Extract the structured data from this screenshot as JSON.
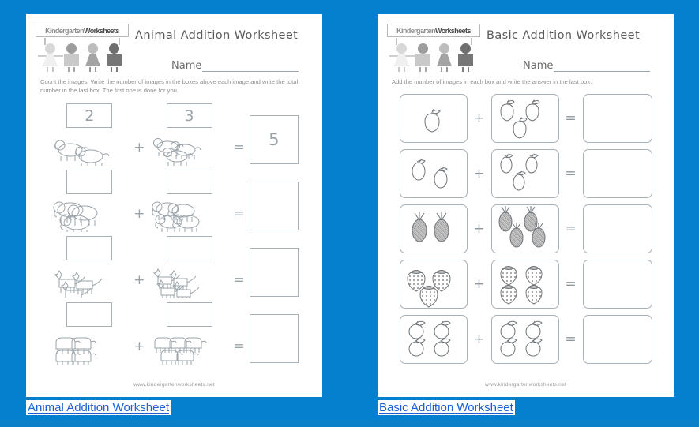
{
  "background_color": "#0480ce",
  "link_color": "#1a5fd6",
  "worksheets": [
    {
      "id": "animal-addition",
      "logo": {
        "word1": "Kindergarten",
        "word2": "Worksheets"
      },
      "title": "Animal Addition Worksheet",
      "name_label": "Name",
      "instructions": "Count the images. Write the number of images in the boxes above each image and write the total number in the last box. The first one is done for you.",
      "footer_url": "www.kindergartenworksheets.net",
      "caption": "Animal Addition Worksheet",
      "plus": "+",
      "equals": "=",
      "rows": [
        {
          "animal": "dog",
          "left_count": 2,
          "right_count": 3,
          "left_value": "2",
          "right_value": "3",
          "answer": "5"
        },
        {
          "animal": "elephant",
          "left_count": 3,
          "right_count": 4,
          "left_value": "",
          "right_value": "",
          "answer": ""
        },
        {
          "animal": "fox",
          "left_count": 3,
          "right_count": 4,
          "left_value": "",
          "right_value": "",
          "answer": ""
        },
        {
          "animal": "hippo",
          "left_count": 4,
          "right_count": 5,
          "left_value": "",
          "right_value": "",
          "answer": ""
        }
      ]
    },
    {
      "id": "basic-addition",
      "logo": {
        "word1": "Kindergarten",
        "word2": "Worksheets"
      },
      "title": "Basic Addition Worksheet",
      "name_label": "Name",
      "instructions": "Add the number of images in each box and write the answer in the last box.",
      "footer_url": "www.kindergartenworksheets.net",
      "caption": "Basic Addition Worksheet",
      "plus": "+",
      "equals": "=",
      "rows": [
        {
          "fruit": "apple",
          "left_count": 1,
          "right_count": 3,
          "answer": ""
        },
        {
          "fruit": "lemon",
          "left_count": 2,
          "right_count": 3,
          "answer": ""
        },
        {
          "fruit": "pineapple",
          "left_count": 2,
          "right_count": 4,
          "answer": ""
        },
        {
          "fruit": "strawberry",
          "left_count": 3,
          "right_count": 4,
          "answer": ""
        },
        {
          "fruit": "orange",
          "left_count": 4,
          "right_count": 4,
          "answer": ""
        }
      ]
    }
  ]
}
